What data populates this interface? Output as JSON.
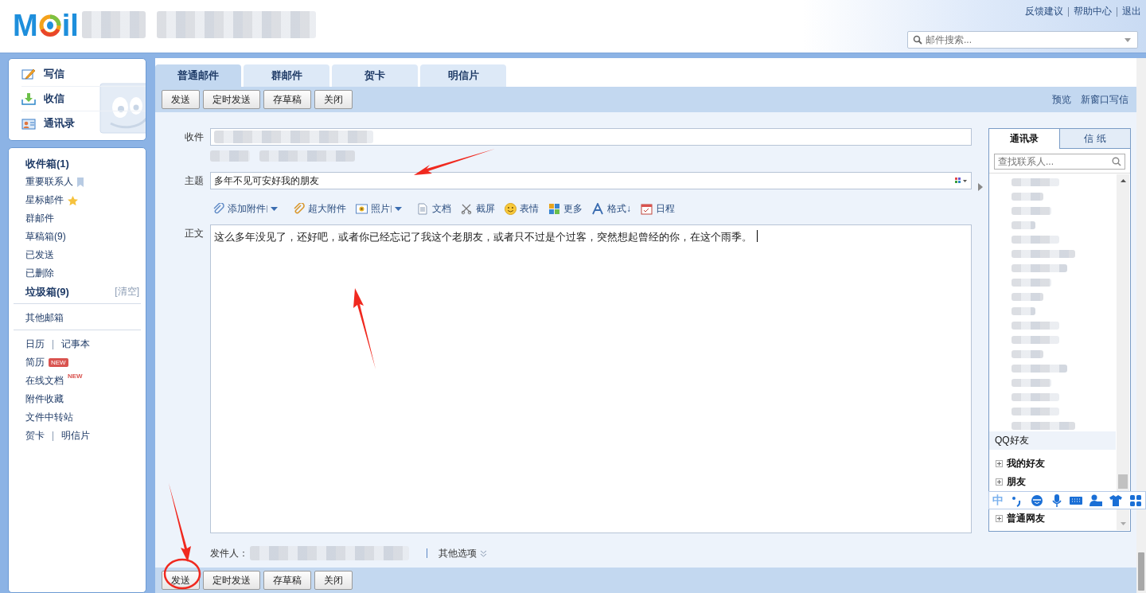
{
  "header": {
    "logo": {
      "left": "M",
      "right": "il"
    },
    "links": [
      "反馈建议",
      "帮助中心",
      "退出"
    ],
    "search": {
      "placeholder": "邮件搜索..."
    }
  },
  "sidebar": {
    "actions": [
      {
        "label": "写信",
        "kind": "compose"
      },
      {
        "label": "收信",
        "kind": "inbox"
      },
      {
        "label": "通讯录",
        "kind": "contacts"
      }
    ],
    "groups": [
      [
        {
          "label": "收件箱(1)",
          "bold": true
        },
        {
          "label": "重要联系人",
          "kind": "bookmarked",
          "bold": false
        },
        {
          "label": "星标邮件",
          "kind": "starred",
          "bold": false
        },
        {
          "label": "群邮件",
          "bold": false
        },
        {
          "label": "草稿箱(9)",
          "bold": false
        },
        {
          "label": "已发送",
          "bold": false
        },
        {
          "label": "已删除",
          "bold": false
        },
        {
          "label": "垃圾箱(9)",
          "bold": true,
          "action": "[清空]"
        }
      ],
      [
        {
          "label": "其他邮箱",
          "bold": false
        }
      ],
      [
        {
          "label": "日历",
          "bold": false,
          "pair": "记事本"
        },
        {
          "label": "简历",
          "bold": false,
          "badge": "NEW",
          "kind": "newbox"
        },
        {
          "label": "在线文档",
          "bold": false,
          "badge": "NEW",
          "kind": "newsup"
        },
        {
          "label": "附件收藏",
          "bold": false
        },
        {
          "label": "文件中转站",
          "bold": false
        },
        {
          "label": "贺卡",
          "bold": false,
          "pair": "明信片"
        }
      ]
    ]
  },
  "compose": {
    "tabs": [
      {
        "label": "普通邮件",
        "selected": true
      },
      {
        "label": "群邮件",
        "selected": false
      },
      {
        "label": "贺卡",
        "selected": false
      },
      {
        "label": "明信片",
        "selected": false
      }
    ],
    "toolbar": [
      "发送",
      "定时发送",
      "存草稿",
      "关闭"
    ],
    "toolbar_links": [
      "预览",
      "新窗口写信"
    ],
    "recipient": {
      "label": "收件"
    },
    "subject": {
      "label": "主题",
      "value": "多年不见可安好我的朋友"
    },
    "editor_tools": [
      {
        "label": "添加附件",
        "kind": "clip",
        "dropdown": true
      },
      {
        "label": "超大附件",
        "kind": "bigclip",
        "dropdown": false
      },
      {
        "label": "照片",
        "kind": "photo",
        "dropdown": true
      },
      {
        "label": "文档",
        "kind": "doc",
        "dropdown": false
      },
      {
        "label": "截屏",
        "kind": "scissors",
        "dropdown": false
      },
      {
        "label": "表情",
        "kind": "smiley",
        "dropdown": false
      },
      {
        "label": "更多",
        "kind": "grid",
        "dropdown": false
      },
      {
        "label": "格式↓",
        "kind": "font",
        "dropdown": false
      },
      {
        "label": "日程",
        "kind": "calendar",
        "dropdown": false
      }
    ],
    "body": {
      "label": "正文",
      "value": "这么多年没见了，还好吧，或者你已经忘记了我这个老朋友，或者只不过是个过客，突然想起曾经的你，在这个雨季。"
    },
    "sender": {
      "label": "发件人：",
      "options": "其他选项"
    },
    "bottom_toolbar": [
      "发送",
      "定时发送",
      "存草稿",
      "关闭"
    ]
  },
  "contacts_panel": {
    "tabs": [
      {
        "label": "通讯录",
        "selected": true
      },
      {
        "label": "信 纸",
        "selected": false
      }
    ],
    "search": {
      "placeholder": "查找联系人..."
    },
    "group_header": "QQ好友",
    "groups": [
      {
        "label": "我的好友",
        "expanded": false
      },
      {
        "label": "朋友",
        "expanded": false
      },
      {
        "label": "普通网友",
        "expanded": false
      }
    ]
  },
  "ime_bar": {
    "mode": "中"
  }
}
